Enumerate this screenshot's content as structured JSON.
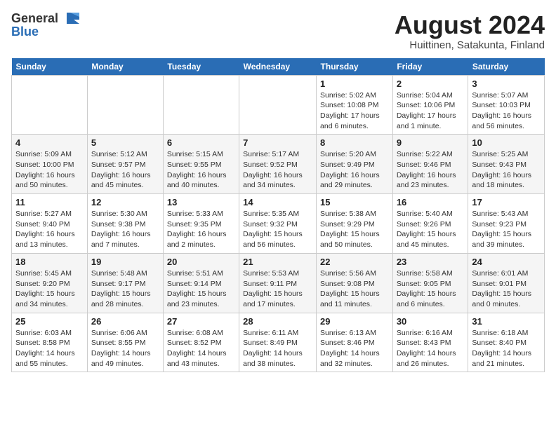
{
  "header": {
    "logo_general": "General",
    "logo_blue": "Blue",
    "month_year": "August 2024",
    "location": "Huittinen, Satakunta, Finland"
  },
  "weekdays": [
    "Sunday",
    "Monday",
    "Tuesday",
    "Wednesday",
    "Thursday",
    "Friday",
    "Saturday"
  ],
  "weeks": [
    [
      {
        "day": "",
        "info": ""
      },
      {
        "day": "",
        "info": ""
      },
      {
        "day": "",
        "info": ""
      },
      {
        "day": "",
        "info": ""
      },
      {
        "day": "1",
        "info": "Sunrise: 5:02 AM\nSunset: 10:08 PM\nDaylight: 17 hours\nand 6 minutes."
      },
      {
        "day": "2",
        "info": "Sunrise: 5:04 AM\nSunset: 10:06 PM\nDaylight: 17 hours\nand 1 minute."
      },
      {
        "day": "3",
        "info": "Sunrise: 5:07 AM\nSunset: 10:03 PM\nDaylight: 16 hours\nand 56 minutes."
      }
    ],
    [
      {
        "day": "4",
        "info": "Sunrise: 5:09 AM\nSunset: 10:00 PM\nDaylight: 16 hours\nand 50 minutes."
      },
      {
        "day": "5",
        "info": "Sunrise: 5:12 AM\nSunset: 9:57 PM\nDaylight: 16 hours\nand 45 minutes."
      },
      {
        "day": "6",
        "info": "Sunrise: 5:15 AM\nSunset: 9:55 PM\nDaylight: 16 hours\nand 40 minutes."
      },
      {
        "day": "7",
        "info": "Sunrise: 5:17 AM\nSunset: 9:52 PM\nDaylight: 16 hours\nand 34 minutes."
      },
      {
        "day": "8",
        "info": "Sunrise: 5:20 AM\nSunset: 9:49 PM\nDaylight: 16 hours\nand 29 minutes."
      },
      {
        "day": "9",
        "info": "Sunrise: 5:22 AM\nSunset: 9:46 PM\nDaylight: 16 hours\nand 23 minutes."
      },
      {
        "day": "10",
        "info": "Sunrise: 5:25 AM\nSunset: 9:43 PM\nDaylight: 16 hours\nand 18 minutes."
      }
    ],
    [
      {
        "day": "11",
        "info": "Sunrise: 5:27 AM\nSunset: 9:40 PM\nDaylight: 16 hours\nand 13 minutes."
      },
      {
        "day": "12",
        "info": "Sunrise: 5:30 AM\nSunset: 9:38 PM\nDaylight: 16 hours\nand 7 minutes."
      },
      {
        "day": "13",
        "info": "Sunrise: 5:33 AM\nSunset: 9:35 PM\nDaylight: 16 hours\nand 2 minutes."
      },
      {
        "day": "14",
        "info": "Sunrise: 5:35 AM\nSunset: 9:32 PM\nDaylight: 15 hours\nand 56 minutes."
      },
      {
        "day": "15",
        "info": "Sunrise: 5:38 AM\nSunset: 9:29 PM\nDaylight: 15 hours\nand 50 minutes."
      },
      {
        "day": "16",
        "info": "Sunrise: 5:40 AM\nSunset: 9:26 PM\nDaylight: 15 hours\nand 45 minutes."
      },
      {
        "day": "17",
        "info": "Sunrise: 5:43 AM\nSunset: 9:23 PM\nDaylight: 15 hours\nand 39 minutes."
      }
    ],
    [
      {
        "day": "18",
        "info": "Sunrise: 5:45 AM\nSunset: 9:20 PM\nDaylight: 15 hours\nand 34 minutes."
      },
      {
        "day": "19",
        "info": "Sunrise: 5:48 AM\nSunset: 9:17 PM\nDaylight: 15 hours\nand 28 minutes."
      },
      {
        "day": "20",
        "info": "Sunrise: 5:51 AM\nSunset: 9:14 PM\nDaylight: 15 hours\nand 23 minutes."
      },
      {
        "day": "21",
        "info": "Sunrise: 5:53 AM\nSunset: 9:11 PM\nDaylight: 15 hours\nand 17 minutes."
      },
      {
        "day": "22",
        "info": "Sunrise: 5:56 AM\nSunset: 9:08 PM\nDaylight: 15 hours\nand 11 minutes."
      },
      {
        "day": "23",
        "info": "Sunrise: 5:58 AM\nSunset: 9:05 PM\nDaylight: 15 hours\nand 6 minutes."
      },
      {
        "day": "24",
        "info": "Sunrise: 6:01 AM\nSunset: 9:01 PM\nDaylight: 15 hours\nand 0 minutes."
      }
    ],
    [
      {
        "day": "25",
        "info": "Sunrise: 6:03 AM\nSunset: 8:58 PM\nDaylight: 14 hours\nand 55 minutes."
      },
      {
        "day": "26",
        "info": "Sunrise: 6:06 AM\nSunset: 8:55 PM\nDaylight: 14 hours\nand 49 minutes."
      },
      {
        "day": "27",
        "info": "Sunrise: 6:08 AM\nSunset: 8:52 PM\nDaylight: 14 hours\nand 43 minutes."
      },
      {
        "day": "28",
        "info": "Sunrise: 6:11 AM\nSunset: 8:49 PM\nDaylight: 14 hours\nand 38 minutes."
      },
      {
        "day": "29",
        "info": "Sunrise: 6:13 AM\nSunset: 8:46 PM\nDaylight: 14 hours\nand 32 minutes."
      },
      {
        "day": "30",
        "info": "Sunrise: 6:16 AM\nSunset: 8:43 PM\nDaylight: 14 hours\nand 26 minutes."
      },
      {
        "day": "31",
        "info": "Sunrise: 6:18 AM\nSunset: 8:40 PM\nDaylight: 14 hours\nand 21 minutes."
      }
    ]
  ]
}
